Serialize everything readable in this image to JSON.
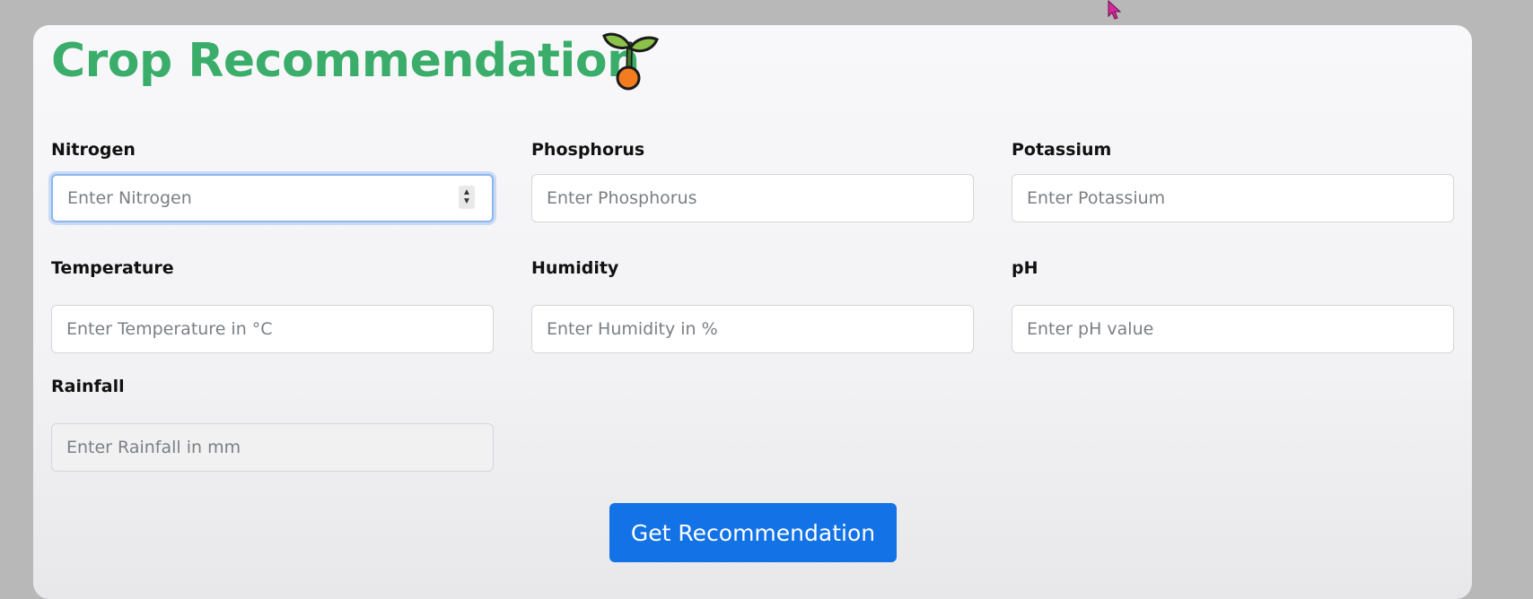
{
  "app": {
    "title": "Crop Recommendation",
    "title_color": "#3aad6a",
    "logo_icon": "sprout-icon"
  },
  "form": {
    "fields": [
      {
        "label": "Nitrogen",
        "placeholder": "Enter Nitrogen",
        "value": ""
      },
      {
        "label": "Phosphorus",
        "placeholder": "Enter Phosphorus",
        "value": ""
      },
      {
        "label": "Potassium",
        "placeholder": "Enter Potassium",
        "value": ""
      },
      {
        "label": "Temperature",
        "placeholder": "Enter Temperature in °C",
        "value": ""
      },
      {
        "label": "Humidity",
        "placeholder": "Enter Humidity in %",
        "value": ""
      },
      {
        "label": "pH",
        "placeholder": "Enter pH value",
        "value": ""
      },
      {
        "label": "Rainfall",
        "placeholder": "Enter Rainfall in mm",
        "value": ""
      }
    ],
    "submit_label": "Get Recommendation",
    "submit_color": "#1272e6"
  },
  "cursor": {
    "icon": "mouse-pointer-icon",
    "color": "#d6279c"
  }
}
